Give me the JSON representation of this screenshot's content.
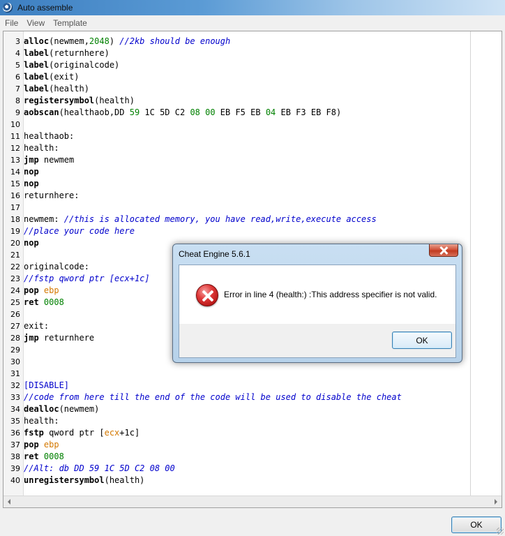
{
  "window": {
    "title": "Auto assemble",
    "icon": "cheat-engine-icon"
  },
  "menu": [
    {
      "label": "File"
    },
    {
      "label": "View"
    },
    {
      "label": "Template"
    }
  ],
  "editor": {
    "lines": [
      {
        "num": "3",
        "tokens": [
          {
            "t": "alloc",
            "c": "kw"
          },
          {
            "t": "(newmem,",
            "c": "txt"
          },
          {
            "t": "2048",
            "c": "num"
          },
          {
            "t": ") ",
            "c": "txt"
          },
          {
            "t": "//2kb should be enough",
            "c": "com"
          }
        ]
      },
      {
        "num": "4",
        "tokens": [
          {
            "t": "label",
            "c": "kw"
          },
          {
            "t": "(returnhere)",
            "c": "txt"
          }
        ]
      },
      {
        "num": "5",
        "tokens": [
          {
            "t": "label",
            "c": "kw"
          },
          {
            "t": "(originalcode)",
            "c": "txt"
          }
        ]
      },
      {
        "num": "6",
        "tokens": [
          {
            "t": "label",
            "c": "kw"
          },
          {
            "t": "(exit)",
            "c": "txt"
          }
        ]
      },
      {
        "num": "7",
        "tokens": [
          {
            "t": "label",
            "c": "kw"
          },
          {
            "t": "(health)",
            "c": "txt"
          }
        ]
      },
      {
        "num": "8",
        "tokens": [
          {
            "t": "registersymbol",
            "c": "kw"
          },
          {
            "t": "(health)",
            "c": "txt"
          }
        ]
      },
      {
        "num": "9",
        "tokens": [
          {
            "t": "aobscan",
            "c": "kw"
          },
          {
            "t": "(healthaob,DD ",
            "c": "txt"
          },
          {
            "t": "59",
            "c": "num"
          },
          {
            "t": " 1C 5D C2 ",
            "c": "txt"
          },
          {
            "t": "08 00",
            "c": "num"
          },
          {
            "t": " EB F5 EB ",
            "c": "txt"
          },
          {
            "t": "04",
            "c": "num"
          },
          {
            "t": " EB F3 EB F8)",
            "c": "txt"
          }
        ]
      },
      {
        "num": "10",
        "tokens": []
      },
      {
        "num": "11",
        "tokens": [
          {
            "t": "healthaob:",
            "c": "txt"
          }
        ]
      },
      {
        "num": "12",
        "tokens": [
          {
            "t": "health:",
            "c": "txt"
          }
        ]
      },
      {
        "num": "13",
        "tokens": [
          {
            "t": "jmp",
            "c": "kw"
          },
          {
            "t": " newmem",
            "c": "txt"
          }
        ]
      },
      {
        "num": "14",
        "tokens": [
          {
            "t": "nop",
            "c": "kw"
          }
        ]
      },
      {
        "num": "15",
        "tokens": [
          {
            "t": "nop",
            "c": "kw"
          }
        ]
      },
      {
        "num": "16",
        "tokens": [
          {
            "t": "returnhere:",
            "c": "txt"
          }
        ]
      },
      {
        "num": "17",
        "tokens": []
      },
      {
        "num": "18",
        "tokens": [
          {
            "t": "newmem: ",
            "c": "txt"
          },
          {
            "t": "//this is allocated memory, you have read,write,execute access",
            "c": "com"
          }
        ]
      },
      {
        "num": "19",
        "tokens": [
          {
            "t": "//place your code here",
            "c": "com"
          }
        ]
      },
      {
        "num": "20",
        "tokens": [
          {
            "t": "nop",
            "c": "kw"
          }
        ]
      },
      {
        "num": "21",
        "tokens": []
      },
      {
        "num": "22",
        "tokens": [
          {
            "t": "originalcode:",
            "c": "txt"
          }
        ]
      },
      {
        "num": "23",
        "tokens": [
          {
            "t": "//fstp qword ptr [ecx+1c]",
            "c": "com"
          }
        ]
      },
      {
        "num": "24",
        "tokens": [
          {
            "t": "pop",
            "c": "kw"
          },
          {
            "t": " ",
            "c": "txt"
          },
          {
            "t": "ebp",
            "c": "reg"
          }
        ]
      },
      {
        "num": "25",
        "tokens": [
          {
            "t": "ret",
            "c": "kw"
          },
          {
            "t": " ",
            "c": "txt"
          },
          {
            "t": "0008",
            "c": "num"
          }
        ]
      },
      {
        "num": "26",
        "tokens": []
      },
      {
        "num": "27",
        "tokens": [
          {
            "t": "exit:",
            "c": "txt"
          }
        ]
      },
      {
        "num": "28",
        "tokens": [
          {
            "t": "jmp",
            "c": "kw"
          },
          {
            "t": " returnhere",
            "c": "txt"
          }
        ]
      },
      {
        "num": "29",
        "tokens": []
      },
      {
        "num": "30",
        "tokens": []
      },
      {
        "num": "31",
        "tokens": []
      },
      {
        "num": "32",
        "tokens": [
          {
            "t": "[DISABLE]",
            "c": "com2"
          }
        ]
      },
      {
        "num": "33",
        "tokens": [
          {
            "t": "//code from here till the end of the code will be used to disable the cheat",
            "c": "com"
          }
        ]
      },
      {
        "num": "34",
        "tokens": [
          {
            "t": "dealloc",
            "c": "kw"
          },
          {
            "t": "(newmem)",
            "c": "txt"
          }
        ]
      },
      {
        "num": "35",
        "tokens": [
          {
            "t": "health:",
            "c": "txt"
          }
        ]
      },
      {
        "num": "36",
        "tokens": [
          {
            "t": "fstp",
            "c": "kw"
          },
          {
            "t": " qword ptr [",
            "c": "txt"
          },
          {
            "t": "ecx",
            "c": "reg"
          },
          {
            "t": "+1c]",
            "c": "txt"
          }
        ]
      },
      {
        "num": "37",
        "tokens": [
          {
            "t": "pop",
            "c": "kw"
          },
          {
            "t": " ",
            "c": "txt"
          },
          {
            "t": "ebp",
            "c": "reg"
          }
        ]
      },
      {
        "num": "38",
        "tokens": [
          {
            "t": "ret",
            "c": "kw"
          },
          {
            "t": " ",
            "c": "txt"
          },
          {
            "t": "0008",
            "c": "num"
          }
        ]
      },
      {
        "num": "39",
        "tokens": [
          {
            "t": "//Alt: db DD 59 1C 5D C2 08 00",
            "c": "com"
          }
        ]
      },
      {
        "num": "40",
        "tokens": [
          {
            "t": "unregistersymbol",
            "c": "kw"
          },
          {
            "t": "(health)",
            "c": "txt"
          }
        ]
      }
    ]
  },
  "bottom": {
    "ok_label": "OK"
  },
  "dialog": {
    "title": "Cheat Engine 5.6.1",
    "message": "Error in line 4 (health:) :This address specifier is not valid.",
    "ok_label": "OK",
    "icon": "error-icon"
  }
}
